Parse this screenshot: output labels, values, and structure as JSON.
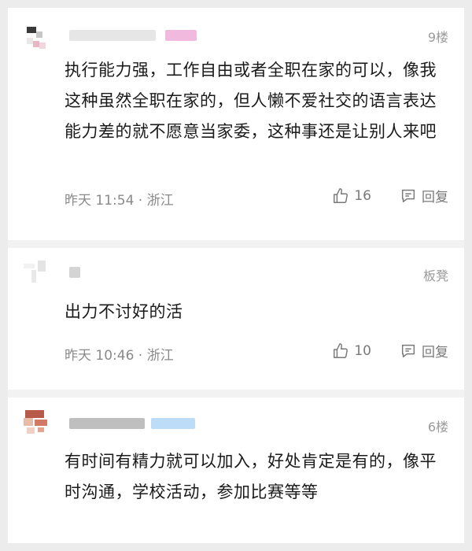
{
  "comments": [
    {
      "floor": "9楼",
      "content": "执行能力强，工作自由或者全职在家的可以，像我这种虽然全职在家的，但人懒不爱社交的语言表达能力差的就不愿意当家委，这种事还是让别人来吧",
      "time": "昨天 11:54 · 浙江",
      "likes": "16",
      "reply_label": "回复",
      "name_color": "#f2b9de"
    },
    {
      "floor": "板凳",
      "content": "出力不讨好的活",
      "time": "昨天 10:46 · 浙江",
      "likes": "10",
      "reply_label": "回复",
      "name_color": "#d6d6d6"
    },
    {
      "floor": "6楼",
      "content": "有时间有精力就可以加入，好处肯定是有的，像平时沟通，学校活动，参加比赛等等",
      "time": "",
      "likes": "",
      "reply_label": "",
      "name_color": "#bcdcf7"
    }
  ],
  "icons": {
    "like": "thumbs-up-icon",
    "reply": "comment-icon"
  }
}
